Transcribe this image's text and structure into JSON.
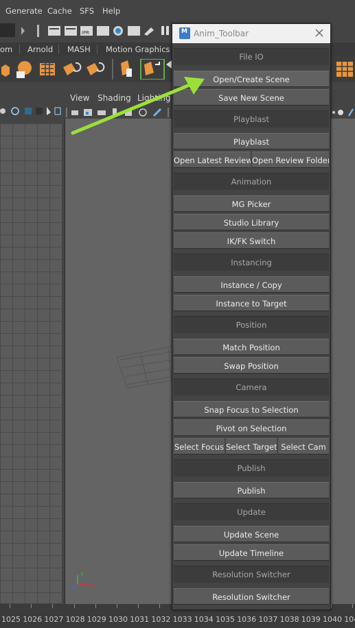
{
  "menubar": {
    "items": [
      "Generate",
      "Cache",
      "SFS",
      "Help"
    ]
  },
  "shelf_tabs": [
    "om",
    "Arnold",
    "MASH",
    "Motion Graphics"
  ],
  "viewport_menu": [
    "View",
    "Shading",
    "Lighting"
  ],
  "axis": {
    "y": "y",
    "x": "x",
    "z": "z"
  },
  "timeline": {
    "frames": [
      "1025",
      "1026",
      "1027",
      "1028",
      "1029",
      "1030",
      "1031",
      "1032",
      "1033",
      "1034",
      "1035",
      "1036",
      "1037",
      "1038",
      "1039",
      "1040",
      "104"
    ]
  },
  "window": {
    "title": "Anim_Toolbar",
    "icon_letter": "M",
    "sections": {
      "file_io": {
        "header": "File IO",
        "buttons": [
          "Open/Create Scene",
          "Save New Scene"
        ]
      },
      "playblast": {
        "header": "Playblast",
        "buttons": [
          "Playblast"
        ],
        "split": [
          "Open Latest Review",
          "Open Review Folder"
        ]
      },
      "animation": {
        "header": "Animation",
        "buttons": [
          "MG Picker",
          "Studio Library",
          "IK/FK Switch"
        ]
      },
      "instancing": {
        "header": "Instancing",
        "buttons": [
          "Instance / Copy",
          "Instance to Target"
        ]
      },
      "position": {
        "header": "Position",
        "buttons": [
          "Match Position",
          "Swap Position"
        ]
      },
      "camera": {
        "header": "Camera",
        "buttons": [
          "Snap Focus to Selection",
          "Pivot on Selection"
        ],
        "split": [
          "Select Focus",
          "Select Target",
          "Select Cam"
        ]
      },
      "publish": {
        "header": "Publish",
        "buttons": [
          "Publish"
        ]
      },
      "update": {
        "header": "Update",
        "buttons": [
          "Update Scene",
          "Update Timeline"
        ]
      },
      "resolution": {
        "header": "Resolution Switcher",
        "buttons": [
          "Resolution Switcher"
        ]
      }
    }
  },
  "colors": {
    "annotation_arrow": "#9be03a",
    "panel_bg": "#444444",
    "button_bg": "#5b5b5b",
    "header_bg": "#3c3c3c"
  }
}
